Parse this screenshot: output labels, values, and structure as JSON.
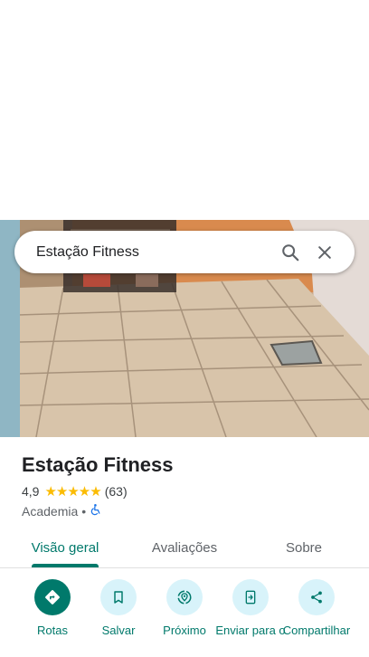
{
  "search": {
    "query": "Estação Fitness"
  },
  "place": {
    "name": "Estação Fitness",
    "rating": "4,9",
    "stars": "★★★★★",
    "review_count": "(63)",
    "category": "Academia",
    "separator": "•"
  },
  "tabs": [
    {
      "label": "Visão geral"
    },
    {
      "label": "Avaliações"
    },
    {
      "label": "Sobre"
    }
  ],
  "actions": [
    {
      "label": "Rotas",
      "icon": "directions-icon"
    },
    {
      "label": "Salvar",
      "icon": "bookmark-icon"
    },
    {
      "label": "Próximo",
      "icon": "nearby-icon"
    },
    {
      "label": "Enviar para o",
      "icon": "send-to-phone-icon"
    },
    {
      "label": "Compartilhar",
      "icon": "share-icon"
    }
  ],
  "colors": {
    "accent": "#00796b",
    "action_bg": "#d8f3fa",
    "star": "#fbbc04"
  }
}
